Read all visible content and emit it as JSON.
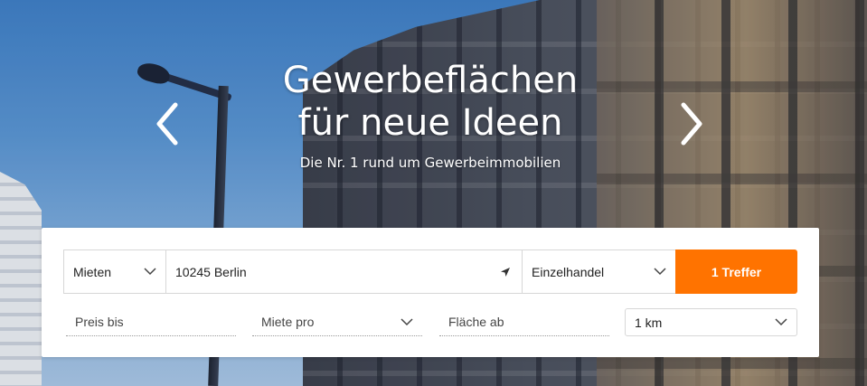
{
  "hero": {
    "title_line1": "Gewerbeflächen",
    "title_line2": "für neue Ideen",
    "subtitle": "Die Nr. 1 rund um Gewerbeimmobilien"
  },
  "search": {
    "transaction_type": "Mieten",
    "location": "10245 Berlin",
    "property_type": "Einzelhandel",
    "submit_label": "1 Treffer",
    "price_max_placeholder": "Preis bis",
    "rent_per_placeholder": "Miete pro",
    "area_min_placeholder": "Fläche ab",
    "radius": "1 km"
  },
  "colors": {
    "accent": "#ff7300",
    "panel_bg": "#ffffff",
    "hero_text": "#ffffff"
  },
  "icons": {
    "prev": "chevron-left-icon",
    "next": "chevron-right-icon",
    "dropdown": "chevron-down-icon",
    "locate": "location-arrow-icon"
  }
}
